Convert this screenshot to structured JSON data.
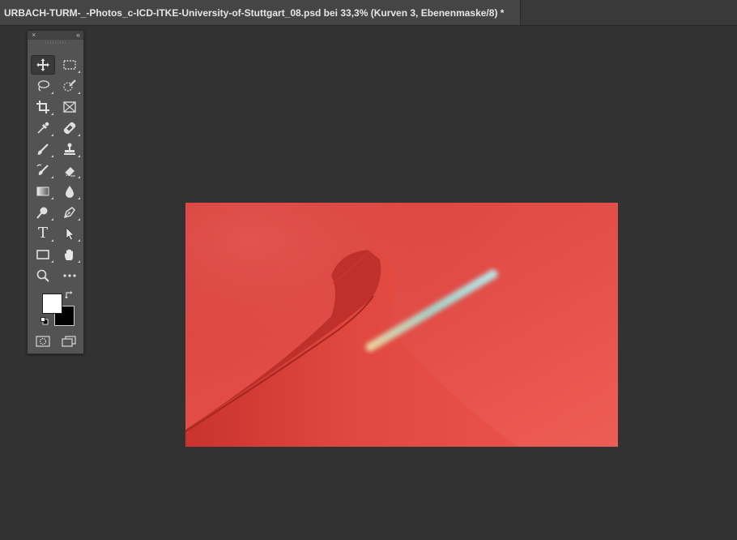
{
  "document": {
    "tab_title": "URBACH-TURM-_-Photos_c-ICD-ITKE-University-of-Stuttgart_08.psd bei 33,3% (Kurven 3, Ebenenmaske/8) *"
  },
  "toolbox": {
    "close_glyph": "×",
    "collapse_glyph": "‹‹",
    "foreground_color": "#ffffff",
    "background_color": "#000000",
    "tools": [
      {
        "name": "move-tool",
        "icon": "move-icon",
        "active": true
      },
      {
        "name": "marquee-tool",
        "icon": "rect-marquee-icon"
      },
      {
        "name": "lasso-tool",
        "icon": "lasso-icon"
      },
      {
        "name": "quick-selection-tool",
        "icon": "quick-selection-icon"
      },
      {
        "name": "crop-tool",
        "icon": "crop-icon"
      },
      {
        "name": "frame-tool",
        "icon": "frame-icon"
      },
      {
        "name": "eyedropper-tool",
        "icon": "eyedropper-icon"
      },
      {
        "name": "healing-brush-tool",
        "icon": "bandage-icon"
      },
      {
        "name": "brush-tool",
        "icon": "brush-icon"
      },
      {
        "name": "clone-stamp-tool",
        "icon": "stamp-icon"
      },
      {
        "name": "history-brush-tool",
        "icon": "history-brush-icon"
      },
      {
        "name": "eraser-tool",
        "icon": "eraser-icon"
      },
      {
        "name": "gradient-tool",
        "icon": "gradient-icon"
      },
      {
        "name": "blur-tool",
        "icon": "drop-icon"
      },
      {
        "name": "dodge-tool",
        "icon": "dodge-icon"
      },
      {
        "name": "pen-tool",
        "icon": "pen-icon"
      },
      {
        "name": "type-tool",
        "icon": "type-icon"
      },
      {
        "name": "path-selection-tool",
        "icon": "arrow-icon"
      },
      {
        "name": "rectangle-tool",
        "icon": "rectangle-icon"
      },
      {
        "name": "hand-tool",
        "icon": "hand-icon"
      },
      {
        "name": "zoom-tool",
        "icon": "zoom-icon"
      },
      {
        "name": "more-tools",
        "icon": "ellipsis-icon"
      }
    ],
    "type_glyph": "T"
  },
  "colors": {
    "app_background": "#323232",
    "panel": "#535353",
    "mask_overlay": "#e0463f"
  }
}
